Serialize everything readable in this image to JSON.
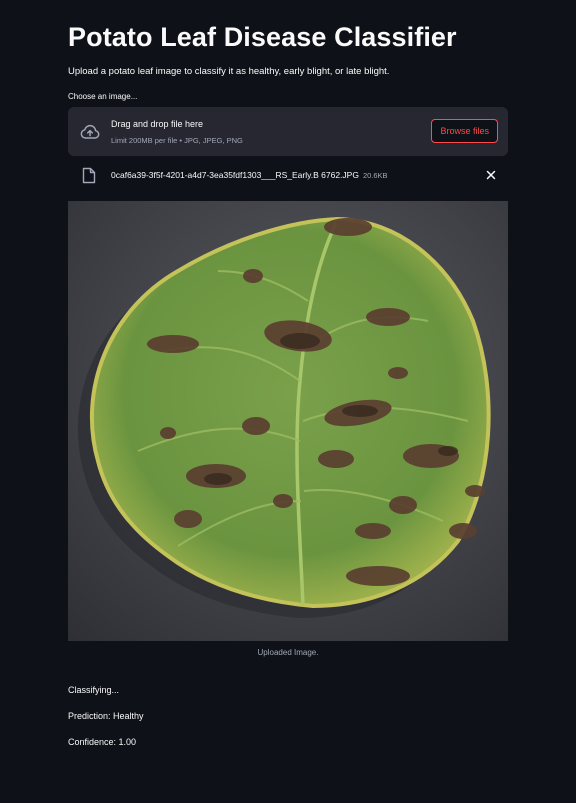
{
  "app": {
    "title": "Potato Leaf Disease Classifier",
    "subtitle": "Upload a potato leaf image to classify it as healthy, early blight, or late blight."
  },
  "uploader": {
    "label": "Choose an image...",
    "drop_title": "Drag and drop file here",
    "drop_limits": "Limit 200MB per file • JPG, JPEG, PNG",
    "browse_label": "Browse files",
    "icon": "cloud-upload-icon"
  },
  "file": {
    "name": "0caf6a39-3f5f-4201-a4d7-3ea35fdf1303___RS_Early.B 6762.JPG",
    "size": "20.6KB",
    "icon": "file-icon"
  },
  "image": {
    "caption": "Uploaded Image."
  },
  "results": {
    "status": "Classifying...",
    "prediction": "Prediction: Healthy",
    "confidence": "Confidence: 1.00"
  },
  "colors": {
    "background": "#0e1117",
    "panel": "#262730",
    "accent": "#ff4b4b",
    "text": "#fafafa",
    "muted": "#a3a8b8"
  }
}
